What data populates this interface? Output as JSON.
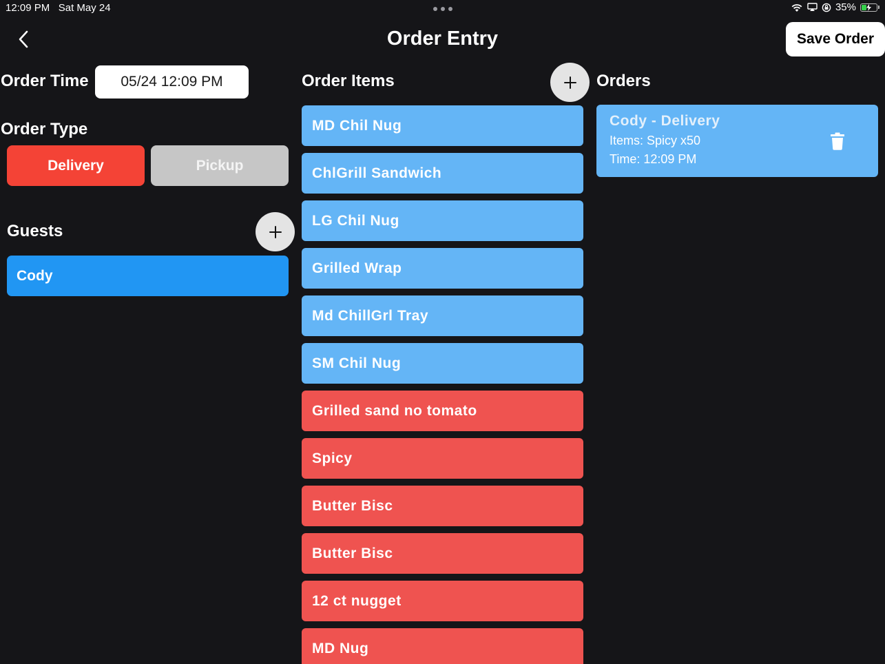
{
  "status_bar": {
    "time": "12:09 PM",
    "date": "Sat May 24",
    "battery_percent": "35%",
    "battery_level": 0.35
  },
  "header": {
    "title": "Order Entry",
    "save_label": "Save Order"
  },
  "order_time": {
    "label": "Order Time",
    "value": "05/24 12:09 PM"
  },
  "order_type": {
    "label": "Order Type",
    "options": [
      {
        "label": "Delivery",
        "selected": true
      },
      {
        "label": "Pickup",
        "selected": false
      }
    ]
  },
  "guests": {
    "label": "Guests",
    "items": [
      {
        "name": "Cody"
      }
    ]
  },
  "order_items": {
    "label": "Order Items",
    "items": [
      {
        "label": "MD Chil Nug",
        "color": "#64b5f6"
      },
      {
        "label": "ChlGrill Sandwich",
        "color": "#64b5f6"
      },
      {
        "label": "LG Chil Nug",
        "color": "#64b5f6"
      },
      {
        "label": "Grilled Wrap",
        "color": "#64b5f6"
      },
      {
        "label": "Md ChillGrl Tray",
        "color": "#64b5f6"
      },
      {
        "label": "SM Chil Nug",
        "color": "#64b5f6"
      },
      {
        "label": "Grilled sand no tomato",
        "color": "#ef5350"
      },
      {
        "label": "Spicy",
        "color": "#ef5350"
      },
      {
        "label": "Butter Bisc",
        "color": "#ef5350"
      },
      {
        "label": "Butter Bisc",
        "color": "#ef5350"
      },
      {
        "label": "12 ct nugget",
        "color": "#ef5350"
      },
      {
        "label": "MD Nug",
        "color": "#ef5350"
      }
    ]
  },
  "orders": {
    "label": "Orders",
    "items": [
      {
        "title": "Cody - Delivery",
        "items_line": "Items: Spicy x50",
        "time_line": "Time: 12:09 PM"
      }
    ]
  },
  "colors": {
    "background": "#151518",
    "accent_blue": "#2196f3",
    "item_blue": "#64b5f6",
    "item_red": "#ef5350",
    "delivery_red": "#f44336",
    "pickup_gray": "#c6c6c6"
  },
  "icons": {
    "back": "chevron-left-icon",
    "add": "plus-icon",
    "delete": "trash-icon",
    "wifi": "wifi-icon",
    "screen_mirror": "screen-mirror-icon",
    "orientation_lock": "orientation-lock-icon",
    "battery": "battery-charging-icon"
  }
}
